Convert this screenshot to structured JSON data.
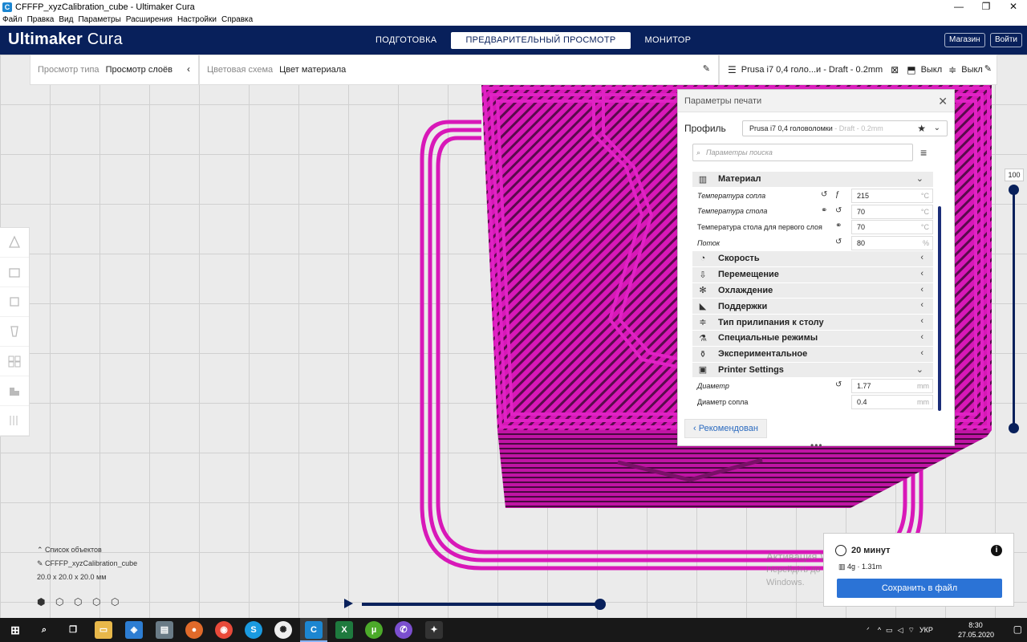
{
  "window": {
    "title": "CFFFP_xyzCalibration_cube - Ultimaker Cura",
    "controls": [
      "—",
      "❐",
      "✕"
    ]
  },
  "menu": [
    "Файл",
    "Правка",
    "Вид",
    "Параметры",
    "Расширения",
    "Настройки",
    "Справка"
  ],
  "header": {
    "logo_bold": "Ultimaker",
    "logo_light": "Cura",
    "stages": [
      "ПОДГОТОВКА",
      "ПРЕДВАРИТЕЛЬНЫЙ ПРОСМОТР",
      "МОНИТОР"
    ],
    "active_stage": "ПРЕДВАРИТЕЛЬНЫЙ ПРОСМОТР",
    "store_button": "Магазин",
    "login_button": "Войти"
  },
  "toolbar": {
    "view_type_label": "Просмотр типа",
    "view_type_value": "Просмотр слоёв",
    "color_scheme_label": "Цветовая схема",
    "color_scheme_value": "Цвет материала",
    "printer_profile": "Prusa i7 0,4 голо...и - Draft - 0.2mm",
    "support_value": "Выкл",
    "adhesion_value": "Выкл"
  },
  "print_settings": {
    "title": "Параметры печати",
    "profile_label": "Профиль",
    "profile_name": "Prusa i7 0,4 головоломки",
    "profile_suffix": "- Draft - 0.2mm",
    "search_placeholder": "Параметры поиска",
    "categories": {
      "material": "Материал",
      "speed": "Скорость",
      "travel": "Перемещение",
      "cooling": "Охлаждение",
      "support": "Поддержки",
      "adhesion": "Тип прилипания к столу",
      "special": "Специальные режимы",
      "experimental": "Экспериментальное",
      "printer": "Printer Settings"
    },
    "material_settings": [
      {
        "label": "Температура сопла",
        "value": "215",
        "unit": "°C"
      },
      {
        "label": "Температура стола",
        "value": "70",
        "unit": "°C"
      },
      {
        "label": "Температура стола для первого слоя",
        "value": "70",
        "unit": "°C"
      },
      {
        "label": "Поток",
        "value": "80",
        "unit": "%"
      }
    ],
    "printer_settings": [
      {
        "label": "Диаметр",
        "value": "1.77",
        "unit": "mm"
      },
      {
        "label": "Диаметр сопла",
        "value": "0.4",
        "unit": "mm"
      }
    ],
    "recommended_button": "Рекомендован"
  },
  "layer_slider": {
    "value": "100"
  },
  "objects": {
    "list_label": "Список объектов",
    "object_name": "CFFFP_xyzCalibration_cube",
    "dimensions": "20.0 x 20.0 x 20.0 мм"
  },
  "output": {
    "print_time": "20 минут",
    "material_usage": "4g · 1.31m",
    "save_button": "Сохранить в файл"
  },
  "watermark": {
    "line1": "Активация Windows",
    "line2": "Перейдіть до розділу \"Настройки\", щоб активувати",
    "line3": "Windows."
  },
  "taskbar": {
    "language": "УКР",
    "time": "8:30",
    "date": "27.05.2020"
  },
  "colors": {
    "header": "#08205b",
    "model": "#d818b8",
    "accent": "#2b73d6"
  }
}
